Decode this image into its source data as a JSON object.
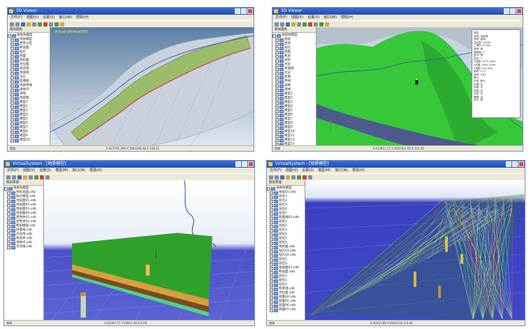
{
  "panels": [
    {
      "title": "3D Viewer",
      "menus": [
        "文件(F)",
        "视图(V)",
        "设置(S)",
        "窗口(W)",
        "帮助(H)"
      ],
      "tree_header": "图层面板",
      "tree_root": "地质体模型",
      "tree_items": [
        "地层模型",
        "岩性分区",
        "断层面",
        "钻孔",
        "剖面",
        "地形面",
        "水位面",
        "构造线",
        "等值线",
        "注记",
        "影像图",
        "地质界线",
        "采样点",
        "测线",
        "地质图",
        "模型1",
        "模型2",
        "模型3",
        "模型4",
        "模型5",
        "模型6",
        "模型7",
        "模型8",
        "模型9",
        "模型10"
      ],
      "view_label": "Virtual Window(3D)",
      "status_left": "就绪",
      "status_coords": "X:423791.296  Y:3581266.48  Z:356.21"
    },
    {
      "title": "3D Viewer",
      "menus": [
        "文件(F)",
        "视图(V)",
        "设置(S)",
        "窗口(W)",
        "帮助(H)"
      ],
      "tree_header": "图层面板",
      "tree_root": "地质体模型",
      "tree_items": [
        "地层",
        "岩体",
        "钻孔",
        "剖面",
        "断层",
        "地形",
        "水位",
        "等值线",
        "注记",
        "影像",
        "界线",
        "采样",
        "测线",
        "模型1",
        "模型2",
        "模型3",
        "模型4",
        "模型5",
        "模型6",
        "模型7",
        "模型8",
        "模型9",
        "模型10",
        "模型11",
        "模型12",
        "模型13"
      ],
      "view_label": "Virtual Window(3D)",
      "properties": [
        "属性",
        "名称: 地层面",
        "类型: 曲面",
        "顶点数: 10262",
        "三角形: 20344",
        "颜色: 绿",
        "透明度: 0",
        "显示: 是",
        "层号: 3",
        "X范围: 4231-4262",
        "Y范围: 3581-3590",
        "Z范围: 120-462",
        "面积: 4.27",
        "体积: 0.83",
        "备注: -",
        "材质: 默认",
        "纹理: 无",
        "光照: 开",
        "线框: 关",
        "法线: 开",
        "编辑: 否",
        "选中: 是"
      ],
      "status_left": "就绪",
      "status_coords": "X:423811.71  Y:3581302.05  Z:312.40"
    },
    {
      "title": "VirtualSystem - [地质模型]",
      "menus": [
        "文件(F)",
        "视图(V)",
        "设置(S)",
        "模型(M)",
        "窗口(W)",
        "帮助(H)"
      ],
      "tree_header": "图层管理",
      "tree_root": "地质体模型",
      "tree_items": [
        "地形表面.sdb",
        "钻孔模型.sdb",
        "地层面01.sdb",
        "地层面02.sdb",
        "地层面03.sdb",
        "地层面04.sdb",
        "岩性体01.sdb",
        "岩性体02.sdb",
        "断层模型.sdb",
        "剖面线.sdb",
        "水位线.sdb",
        "构造体.sdb",
        "采样点.sdb",
        "河流线.sdb"
      ],
      "status_left": "就绪",
      "status_coords": "X:42367.51  Y:35812.40  Z:0.00"
    },
    {
      "title": "VirtualSystem - [地质模型]",
      "menus": [
        "文件(F)",
        "视图(V)",
        "设置(S)",
        "模型(M)",
        "窗口(W)",
        "帮助(H)"
      ],
      "tree_header": "图层管理",
      "tree_root": "地质体模型",
      "tree_items": [
        "地层01.sdb",
        "层位1",
        "层位2",
        "层位3",
        "层位4",
        "层位5",
        "剖面线02.sdb",
        "层位1",
        "层位2",
        "层位3",
        "层位4",
        "层位5",
        "层位6",
        "地形面.sdb",
        "钻孔01.sdb",
        "钻孔02.sdb",
        "层位1",
        "层位2",
        "地层面03.sdb",
        "断层面.sdb",
        "层位1",
        "层位2",
        "层位3",
        "构造线.sdb",
        "水位面.sdb",
        "剖面04.sdb",
        "剖面05.sdb",
        "剖面06.sdb",
        "剖面07.sdb"
      ],
      "status_left": "就绪",
      "status_coords": "X:42411.88  Y:35816.02  Z:0.00"
    }
  ]
}
